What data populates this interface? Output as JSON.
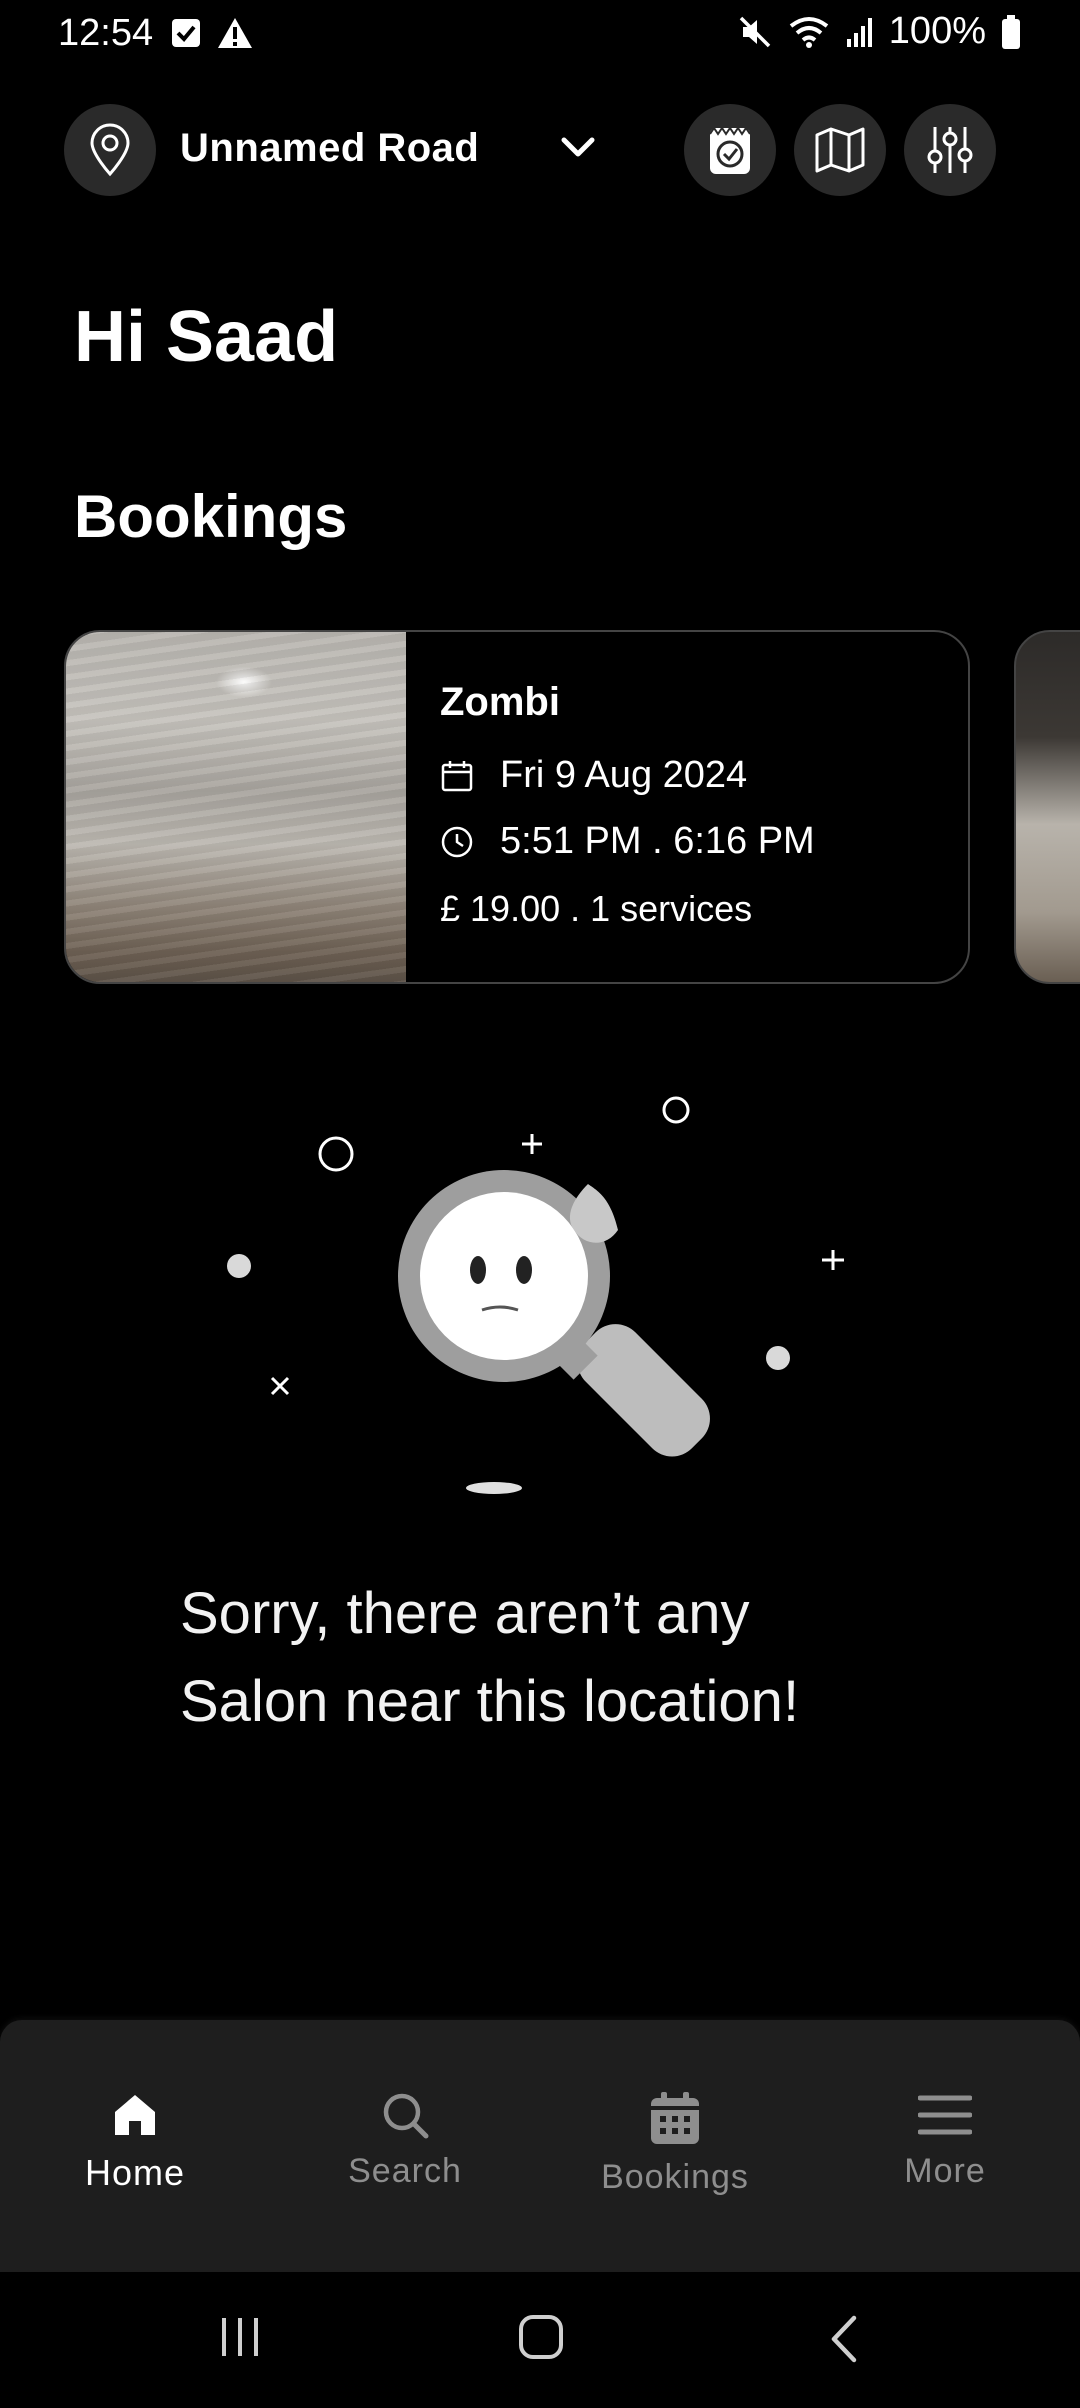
{
  "status_bar": {
    "time": "12:54",
    "battery": "100%"
  },
  "header": {
    "location_name": "Unnamed Road"
  },
  "greeting": "Hi Saad",
  "bookings_section": {
    "title": "Bookings",
    "items": [
      {
        "salon": "Zombi",
        "date": "Fri 9 Aug 2024",
        "time": "5:51 PM . 6:16 PM",
        "price": "£ 19.00 . 1 services"
      }
    ]
  },
  "empty_state": {
    "line1": "Sorry, there aren’t any",
    "line2": "Salon near this location!"
  },
  "bottom_nav": {
    "items": [
      {
        "label": "Home",
        "icon": "home-icon",
        "active": true
      },
      {
        "label": "Search",
        "icon": "search-icon",
        "active": false
      },
      {
        "label": "Bookings",
        "icon": "calendar-icon",
        "active": false
      },
      {
        "label": "More",
        "icon": "menu-icon",
        "active": false
      }
    ]
  },
  "colors": {
    "background": "#000000",
    "card_border": "#444444",
    "nav_background": "#1e1e1e",
    "inactive": "#8e8e8e",
    "icon_button_bg": "#2a2a2a"
  }
}
